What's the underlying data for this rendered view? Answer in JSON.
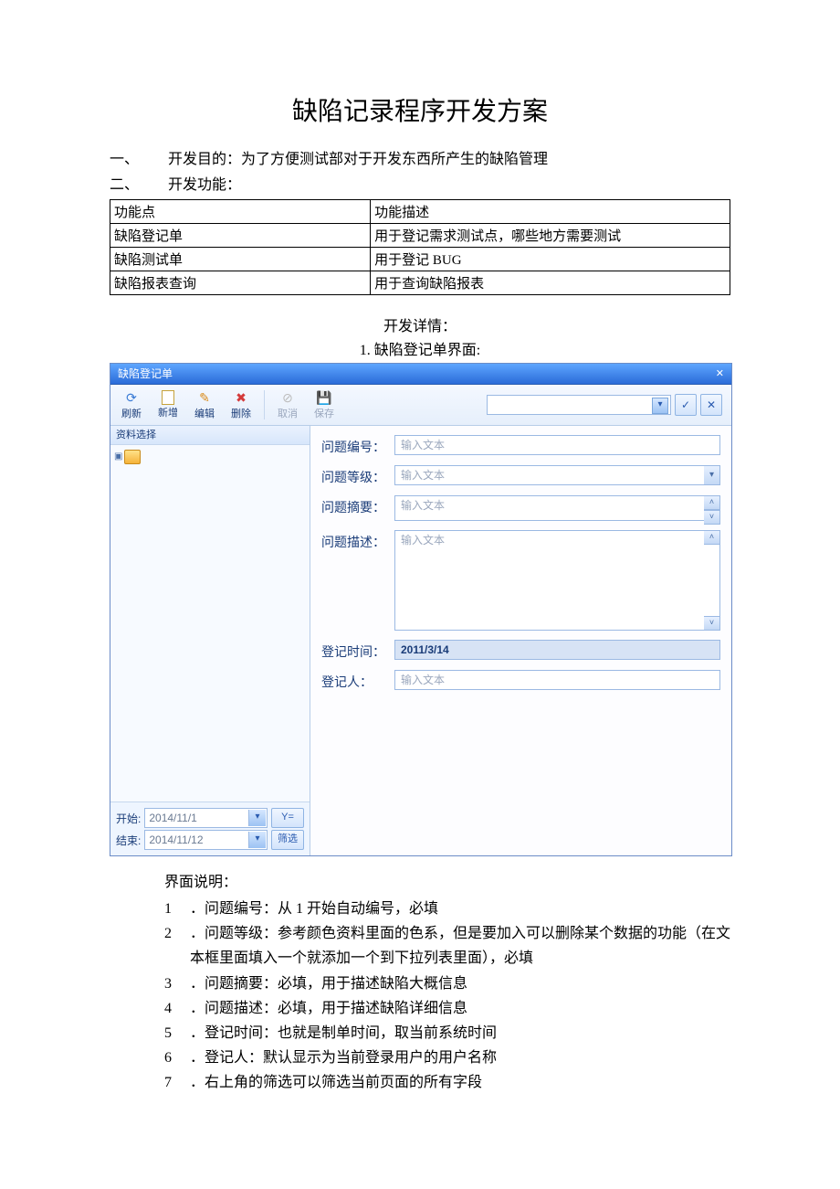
{
  "doc": {
    "title": "缺陷记录程序开发方案",
    "section1_num": "一、",
    "section1_text": "开发目的：为了方便测试部对于开发东西所产生的缺陷管理",
    "section2_num": "二、",
    "section2_text": "开发功能：",
    "func_table": {
      "head_left": "功能点",
      "head_right": "功能描述",
      "rows": [
        {
          "l": "缺陷登记单",
          "r": "用于登记需求测试点，哪些地方需要测试"
        },
        {
          "l": "缺陷测试单",
          "r": "用于登记 BUG"
        },
        {
          "l": "缺陷报表查询",
          "r": "用于查询缺陷报表"
        }
      ]
    },
    "dev_detail": "开发详情：",
    "ui_caption": "1. 缺陷登记单界面:"
  },
  "app": {
    "window_title": "缺陷登记单",
    "toolbar": {
      "refresh": "刷新",
      "add": "新增",
      "edit": "编辑",
      "delete": "删除",
      "cancel": "取消",
      "save": "保存"
    },
    "left": {
      "pane_head": "资料选择",
      "start_label": "开始:",
      "start_value": "2014/11/1",
      "end_label": "结束:",
      "end_value": "2014/11/12",
      "filter_btn": "筛选",
      "y_btn": "Y="
    },
    "form": {
      "f1_label": "问题编号：",
      "f1_ph": "输入文本",
      "f2_label": "问题等级：",
      "f2_ph": "输入文本",
      "f3_label": "问题摘要：",
      "f3_ph": "输入文本",
      "f4_label": "问题描述：",
      "f4_ph": "输入文本",
      "f5_label": "登记时间：",
      "f5_val": "2011/3/14",
      "f6_label": "登记人：",
      "f6_ph": "输入文本"
    }
  },
  "explain": {
    "head": "界面说明：",
    "items": [
      {
        "n": "1",
        "t": "．问题编号：从 1 开始自动编号，必填"
      },
      {
        "n": "2",
        "t": "．问题等级：参考颜色资料里面的色系，但是要加入可以删除某个数据的功能（在文本框里面填入一个就添加一个到下拉列表里面），必填"
      },
      {
        "n": "3",
        "t": "．问题摘要：必填，用于描述缺陷大概信息"
      },
      {
        "n": "4",
        "t": "．问题描述：必填，用于描述缺陷详细信息"
      },
      {
        "n": "5",
        "t": "．登记时间：也就是制单时间，取当前系统时间"
      },
      {
        "n": "6",
        "t": "．登记人：默认显示为当前登录用户的用户名称"
      },
      {
        "n": "7",
        "t": "．右上角的筛选可以筛选当前页面的所有字段"
      }
    ]
  }
}
